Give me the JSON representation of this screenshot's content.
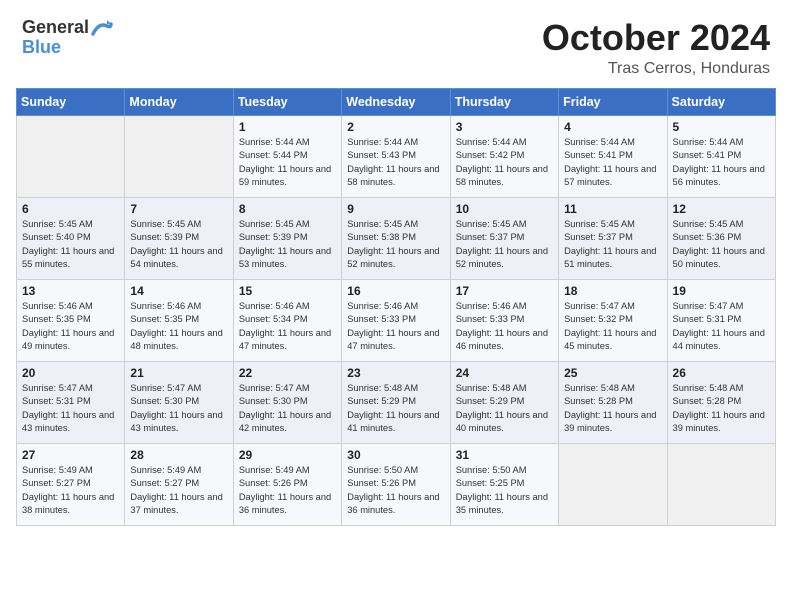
{
  "header": {
    "logo_general": "General",
    "logo_blue": "Blue",
    "title": "October 2024",
    "subtitle": "Tras Cerros, Honduras"
  },
  "columns": [
    "Sunday",
    "Monday",
    "Tuesday",
    "Wednesday",
    "Thursday",
    "Friday",
    "Saturday"
  ],
  "weeks": [
    [
      {
        "day": "",
        "sunrise": "",
        "sunset": "",
        "daylight": ""
      },
      {
        "day": "",
        "sunrise": "",
        "sunset": "",
        "daylight": ""
      },
      {
        "day": "1",
        "sunrise": "Sunrise: 5:44 AM",
        "sunset": "Sunset: 5:44 PM",
        "daylight": "Daylight: 11 hours and 59 minutes."
      },
      {
        "day": "2",
        "sunrise": "Sunrise: 5:44 AM",
        "sunset": "Sunset: 5:43 PM",
        "daylight": "Daylight: 11 hours and 58 minutes."
      },
      {
        "day": "3",
        "sunrise": "Sunrise: 5:44 AM",
        "sunset": "Sunset: 5:42 PM",
        "daylight": "Daylight: 11 hours and 58 minutes."
      },
      {
        "day": "4",
        "sunrise": "Sunrise: 5:44 AM",
        "sunset": "Sunset: 5:41 PM",
        "daylight": "Daylight: 11 hours and 57 minutes."
      },
      {
        "day": "5",
        "sunrise": "Sunrise: 5:44 AM",
        "sunset": "Sunset: 5:41 PM",
        "daylight": "Daylight: 11 hours and 56 minutes."
      }
    ],
    [
      {
        "day": "6",
        "sunrise": "Sunrise: 5:45 AM",
        "sunset": "Sunset: 5:40 PM",
        "daylight": "Daylight: 11 hours and 55 minutes."
      },
      {
        "day": "7",
        "sunrise": "Sunrise: 5:45 AM",
        "sunset": "Sunset: 5:39 PM",
        "daylight": "Daylight: 11 hours and 54 minutes."
      },
      {
        "day": "8",
        "sunrise": "Sunrise: 5:45 AM",
        "sunset": "Sunset: 5:39 PM",
        "daylight": "Daylight: 11 hours and 53 minutes."
      },
      {
        "day": "9",
        "sunrise": "Sunrise: 5:45 AM",
        "sunset": "Sunset: 5:38 PM",
        "daylight": "Daylight: 11 hours and 52 minutes."
      },
      {
        "day": "10",
        "sunrise": "Sunrise: 5:45 AM",
        "sunset": "Sunset: 5:37 PM",
        "daylight": "Daylight: 11 hours and 52 minutes."
      },
      {
        "day": "11",
        "sunrise": "Sunrise: 5:45 AM",
        "sunset": "Sunset: 5:37 PM",
        "daylight": "Daylight: 11 hours and 51 minutes."
      },
      {
        "day": "12",
        "sunrise": "Sunrise: 5:45 AM",
        "sunset": "Sunset: 5:36 PM",
        "daylight": "Daylight: 11 hours and 50 minutes."
      }
    ],
    [
      {
        "day": "13",
        "sunrise": "Sunrise: 5:46 AM",
        "sunset": "Sunset: 5:35 PM",
        "daylight": "Daylight: 11 hours and 49 minutes."
      },
      {
        "day": "14",
        "sunrise": "Sunrise: 5:46 AM",
        "sunset": "Sunset: 5:35 PM",
        "daylight": "Daylight: 11 hours and 48 minutes."
      },
      {
        "day": "15",
        "sunrise": "Sunrise: 5:46 AM",
        "sunset": "Sunset: 5:34 PM",
        "daylight": "Daylight: 11 hours and 47 minutes."
      },
      {
        "day": "16",
        "sunrise": "Sunrise: 5:46 AM",
        "sunset": "Sunset: 5:33 PM",
        "daylight": "Daylight: 11 hours and 47 minutes."
      },
      {
        "day": "17",
        "sunrise": "Sunrise: 5:46 AM",
        "sunset": "Sunset: 5:33 PM",
        "daylight": "Daylight: 11 hours and 46 minutes."
      },
      {
        "day": "18",
        "sunrise": "Sunrise: 5:47 AM",
        "sunset": "Sunset: 5:32 PM",
        "daylight": "Daylight: 11 hours and 45 minutes."
      },
      {
        "day": "19",
        "sunrise": "Sunrise: 5:47 AM",
        "sunset": "Sunset: 5:31 PM",
        "daylight": "Daylight: 11 hours and 44 minutes."
      }
    ],
    [
      {
        "day": "20",
        "sunrise": "Sunrise: 5:47 AM",
        "sunset": "Sunset: 5:31 PM",
        "daylight": "Daylight: 11 hours and 43 minutes."
      },
      {
        "day": "21",
        "sunrise": "Sunrise: 5:47 AM",
        "sunset": "Sunset: 5:30 PM",
        "daylight": "Daylight: 11 hours and 43 minutes."
      },
      {
        "day": "22",
        "sunrise": "Sunrise: 5:47 AM",
        "sunset": "Sunset: 5:30 PM",
        "daylight": "Daylight: 11 hours and 42 minutes."
      },
      {
        "day": "23",
        "sunrise": "Sunrise: 5:48 AM",
        "sunset": "Sunset: 5:29 PM",
        "daylight": "Daylight: 11 hours and 41 minutes."
      },
      {
        "day": "24",
        "sunrise": "Sunrise: 5:48 AM",
        "sunset": "Sunset: 5:29 PM",
        "daylight": "Daylight: 11 hours and 40 minutes."
      },
      {
        "day": "25",
        "sunrise": "Sunrise: 5:48 AM",
        "sunset": "Sunset: 5:28 PM",
        "daylight": "Daylight: 11 hours and 39 minutes."
      },
      {
        "day": "26",
        "sunrise": "Sunrise: 5:48 AM",
        "sunset": "Sunset: 5:28 PM",
        "daylight": "Daylight: 11 hours and 39 minutes."
      }
    ],
    [
      {
        "day": "27",
        "sunrise": "Sunrise: 5:49 AM",
        "sunset": "Sunset: 5:27 PM",
        "daylight": "Daylight: 11 hours and 38 minutes."
      },
      {
        "day": "28",
        "sunrise": "Sunrise: 5:49 AM",
        "sunset": "Sunset: 5:27 PM",
        "daylight": "Daylight: 11 hours and 37 minutes."
      },
      {
        "day": "29",
        "sunrise": "Sunrise: 5:49 AM",
        "sunset": "Sunset: 5:26 PM",
        "daylight": "Daylight: 11 hours and 36 minutes."
      },
      {
        "day": "30",
        "sunrise": "Sunrise: 5:50 AM",
        "sunset": "Sunset: 5:26 PM",
        "daylight": "Daylight: 11 hours and 36 minutes."
      },
      {
        "day": "31",
        "sunrise": "Sunrise: 5:50 AM",
        "sunset": "Sunset: 5:25 PM",
        "daylight": "Daylight: 11 hours and 35 minutes."
      },
      {
        "day": "",
        "sunrise": "",
        "sunset": "",
        "daylight": ""
      },
      {
        "day": "",
        "sunrise": "",
        "sunset": "",
        "daylight": ""
      }
    ]
  ]
}
